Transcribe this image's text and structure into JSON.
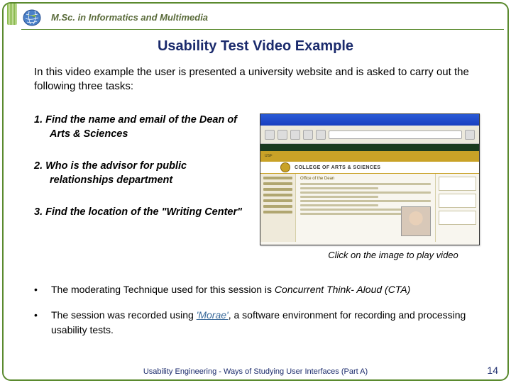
{
  "header": {
    "program": "M.Sc. in Informatics and Multimedia"
  },
  "title": "Usability Test Video Example",
  "intro": "In this video example the user is presented a university website and is asked to carry out the following three tasks:",
  "tasks": [
    "1.  Find the name and email of the Dean of Arts & Sciences",
    "2.  Who is the advisor for public relationships department",
    "3.  Find the location of the \"Writing Center\""
  ],
  "thumbnail": {
    "college_label": "COLLEGE OF ARTS & SCIENCES",
    "section_heading": "Office of the Dean"
  },
  "caption": "Click on the image to play video",
  "bullets": [
    {
      "pre": "The moderating Technique used for this session is ",
      "em": "Concurrent Think- Aloud (CTA)",
      "post": ""
    },
    {
      "pre": "The session was recorded using ",
      "link": "'Morae'",
      "post": ", a software environment for recording and processing usability tests."
    }
  ],
  "footer": "Usability Engineering  -  Ways of Studying User Interfaces (Part A)",
  "page_number": "14"
}
